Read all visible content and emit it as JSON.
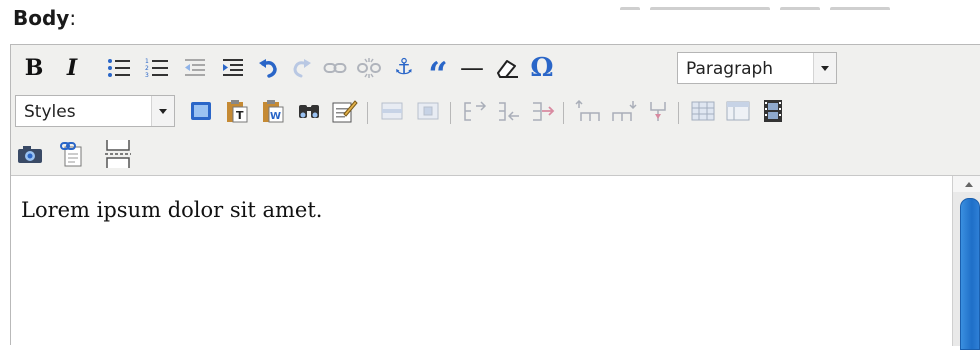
{
  "field": {
    "label": "Body",
    "colon": ":"
  },
  "toolbar": {
    "row1": {
      "bold": {
        "glyph": "B",
        "icon": "bold-icon"
      },
      "italic": {
        "glyph": "I",
        "icon": "italic-icon"
      },
      "bullet_list": {
        "icon": "unordered-list-icon"
      },
      "numbered_list": {
        "icon": "ordered-list-icon"
      },
      "outdent": {
        "icon": "outdent-icon"
      },
      "indent": {
        "icon": "indent-icon"
      },
      "undo": {
        "icon": "undo-icon"
      },
      "redo": {
        "icon": "redo-icon"
      },
      "link": {
        "icon": "link-icon"
      },
      "unlink": {
        "icon": "unlink-icon"
      },
      "anchor": {
        "glyph": "⚓",
        "icon": "anchor-icon"
      },
      "blockquote": {
        "glyph": "“",
        "icon": "blockquote-icon"
      },
      "horizontal_rule": {
        "glyph": "—",
        "icon": "horizontal-rule-icon"
      },
      "remove_format": {
        "icon": "eraser-icon"
      },
      "special_char": {
        "glyph": "Ω",
        "icon": "omega-icon"
      },
      "format_select": {
        "value": "Paragraph"
      }
    },
    "row2": {
      "styles_select": {
        "value": "Styles"
      },
      "icons": [
        "fullscreen-icon",
        "paste-text-icon",
        "paste-word-icon",
        "find-icon",
        "edit-icon",
        "table-row-icon",
        "table-cell-icon",
        "col-before-icon",
        "col-after-icon",
        "col-delete-icon",
        "row-before-icon",
        "row-after-icon",
        "split-cells-icon",
        "table-icon",
        "table-props-icon",
        "media-icon"
      ]
    },
    "row3": {
      "icons": [
        "image-icon",
        "link-clip-icon",
        "page-break-icon"
      ]
    }
  },
  "content": {
    "text": "Lorem ipsum dolor sit amet."
  },
  "colors": {
    "toolbar_bg": "#f0f0ee",
    "icon_blue": "#2a66c8",
    "icon_gray": "#9fa4b0",
    "scroll_thumb": "#2a7fd9"
  }
}
